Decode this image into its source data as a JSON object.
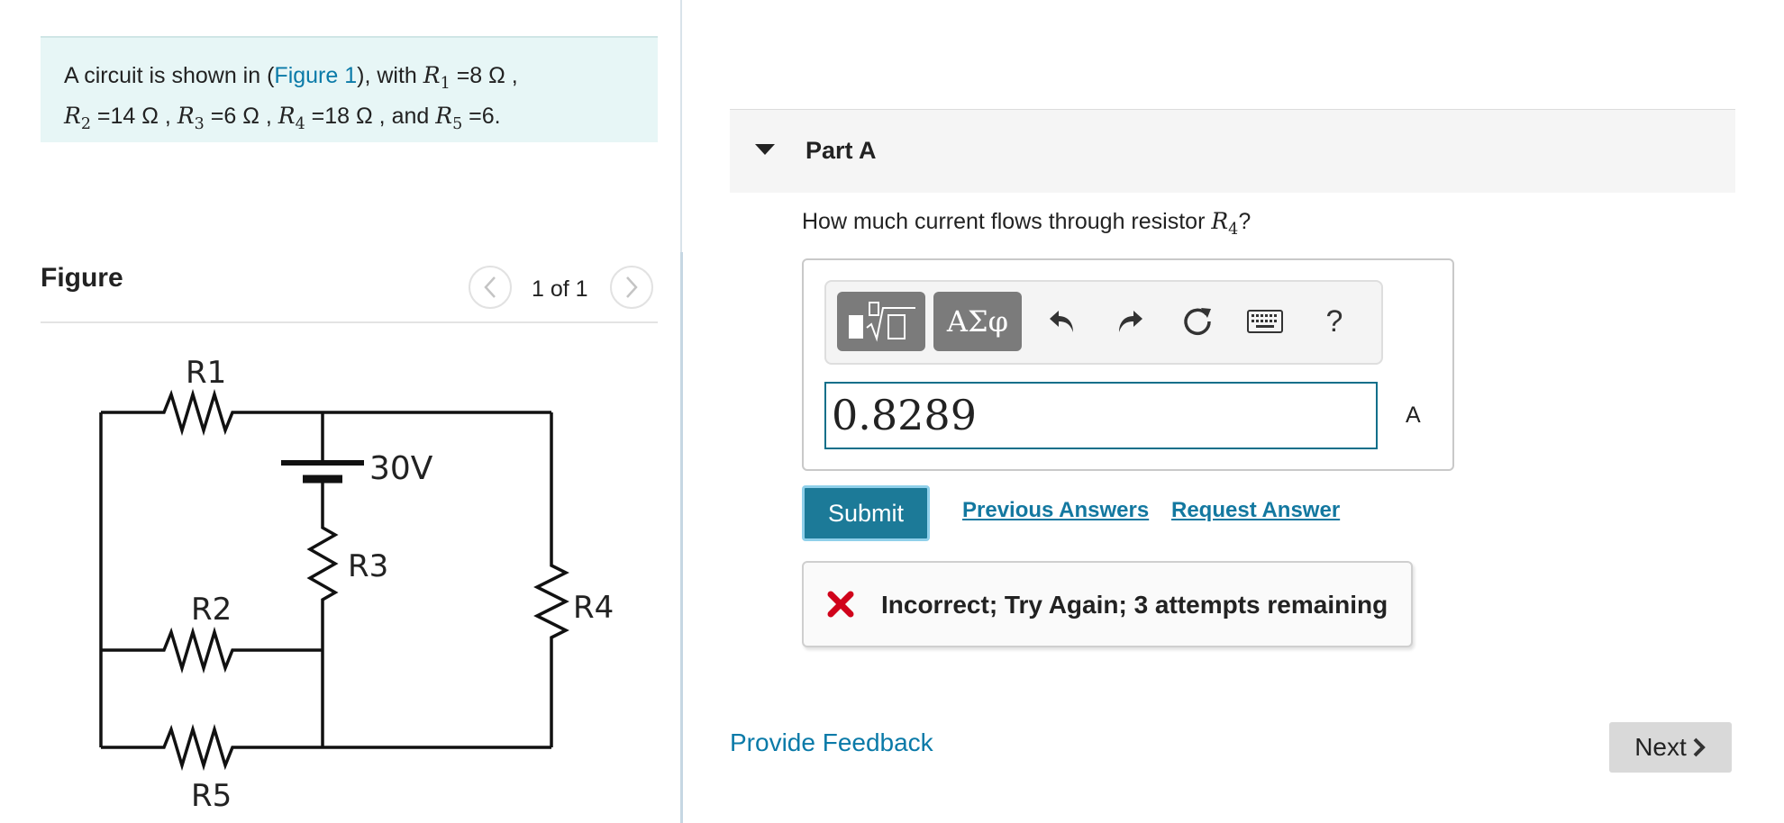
{
  "problem": {
    "intro": "A circuit is shown in (",
    "figure_link": "Figure 1",
    "after_link": "), with ",
    "values": {
      "r1": "8 Ω",
      "r2": "14 Ω",
      "r3": "6 Ω",
      "r4": "18 Ω",
      "r5": "6"
    },
    "symbols": {
      "r1_base": "R",
      "r1_sub": "1",
      "r2_base": "R",
      "r2_sub": "2",
      "r3_base": "R",
      "r3_sub": "3",
      "r4_base": "R",
      "r4_sub": "4",
      "r5_base": "R",
      "r5_sub": "5"
    },
    "eq": "=",
    "sep": " , ",
    "and": " , and ",
    "end": "."
  },
  "figure": {
    "title": "Figure",
    "counter": "1 of 1",
    "prev_icon": "chevron-left-icon",
    "next_icon": "chevron-right-icon",
    "circuit": {
      "battery_label": "30V",
      "r1": "R1",
      "r2": "R2",
      "r3": "R3",
      "r4": "R4",
      "r5": "R5"
    }
  },
  "part": {
    "title": "Part A",
    "question_text": "How much current flows through resistor ",
    "question_var_base": "R",
    "question_var_sub": "4",
    "question_end": "?"
  },
  "toolbar": {
    "templates_icon": "templates-sqrt-icon",
    "symbols_label": "ΑΣφ",
    "undo_icon": "undo-icon",
    "redo_icon": "redo-icon",
    "reset_icon": "reset-icon",
    "keyboard_icon": "keyboard-icon",
    "help_label": "?"
  },
  "answer": {
    "value": "0.8289",
    "unit": "A"
  },
  "actions": {
    "submit": "Submit",
    "previous_answers": "Previous Answers",
    "request_answer": "Request Answer"
  },
  "feedback": {
    "message": "Incorrect; Try Again; 3 attempts remaining",
    "status_color": "#d0021b"
  },
  "footer": {
    "provide_feedback": "Provide Feedback",
    "next": "Next"
  },
  "colors": {
    "accent": "#1c7a98",
    "link": "#0a7aa8",
    "problem_bg": "#e7f6f6"
  }
}
